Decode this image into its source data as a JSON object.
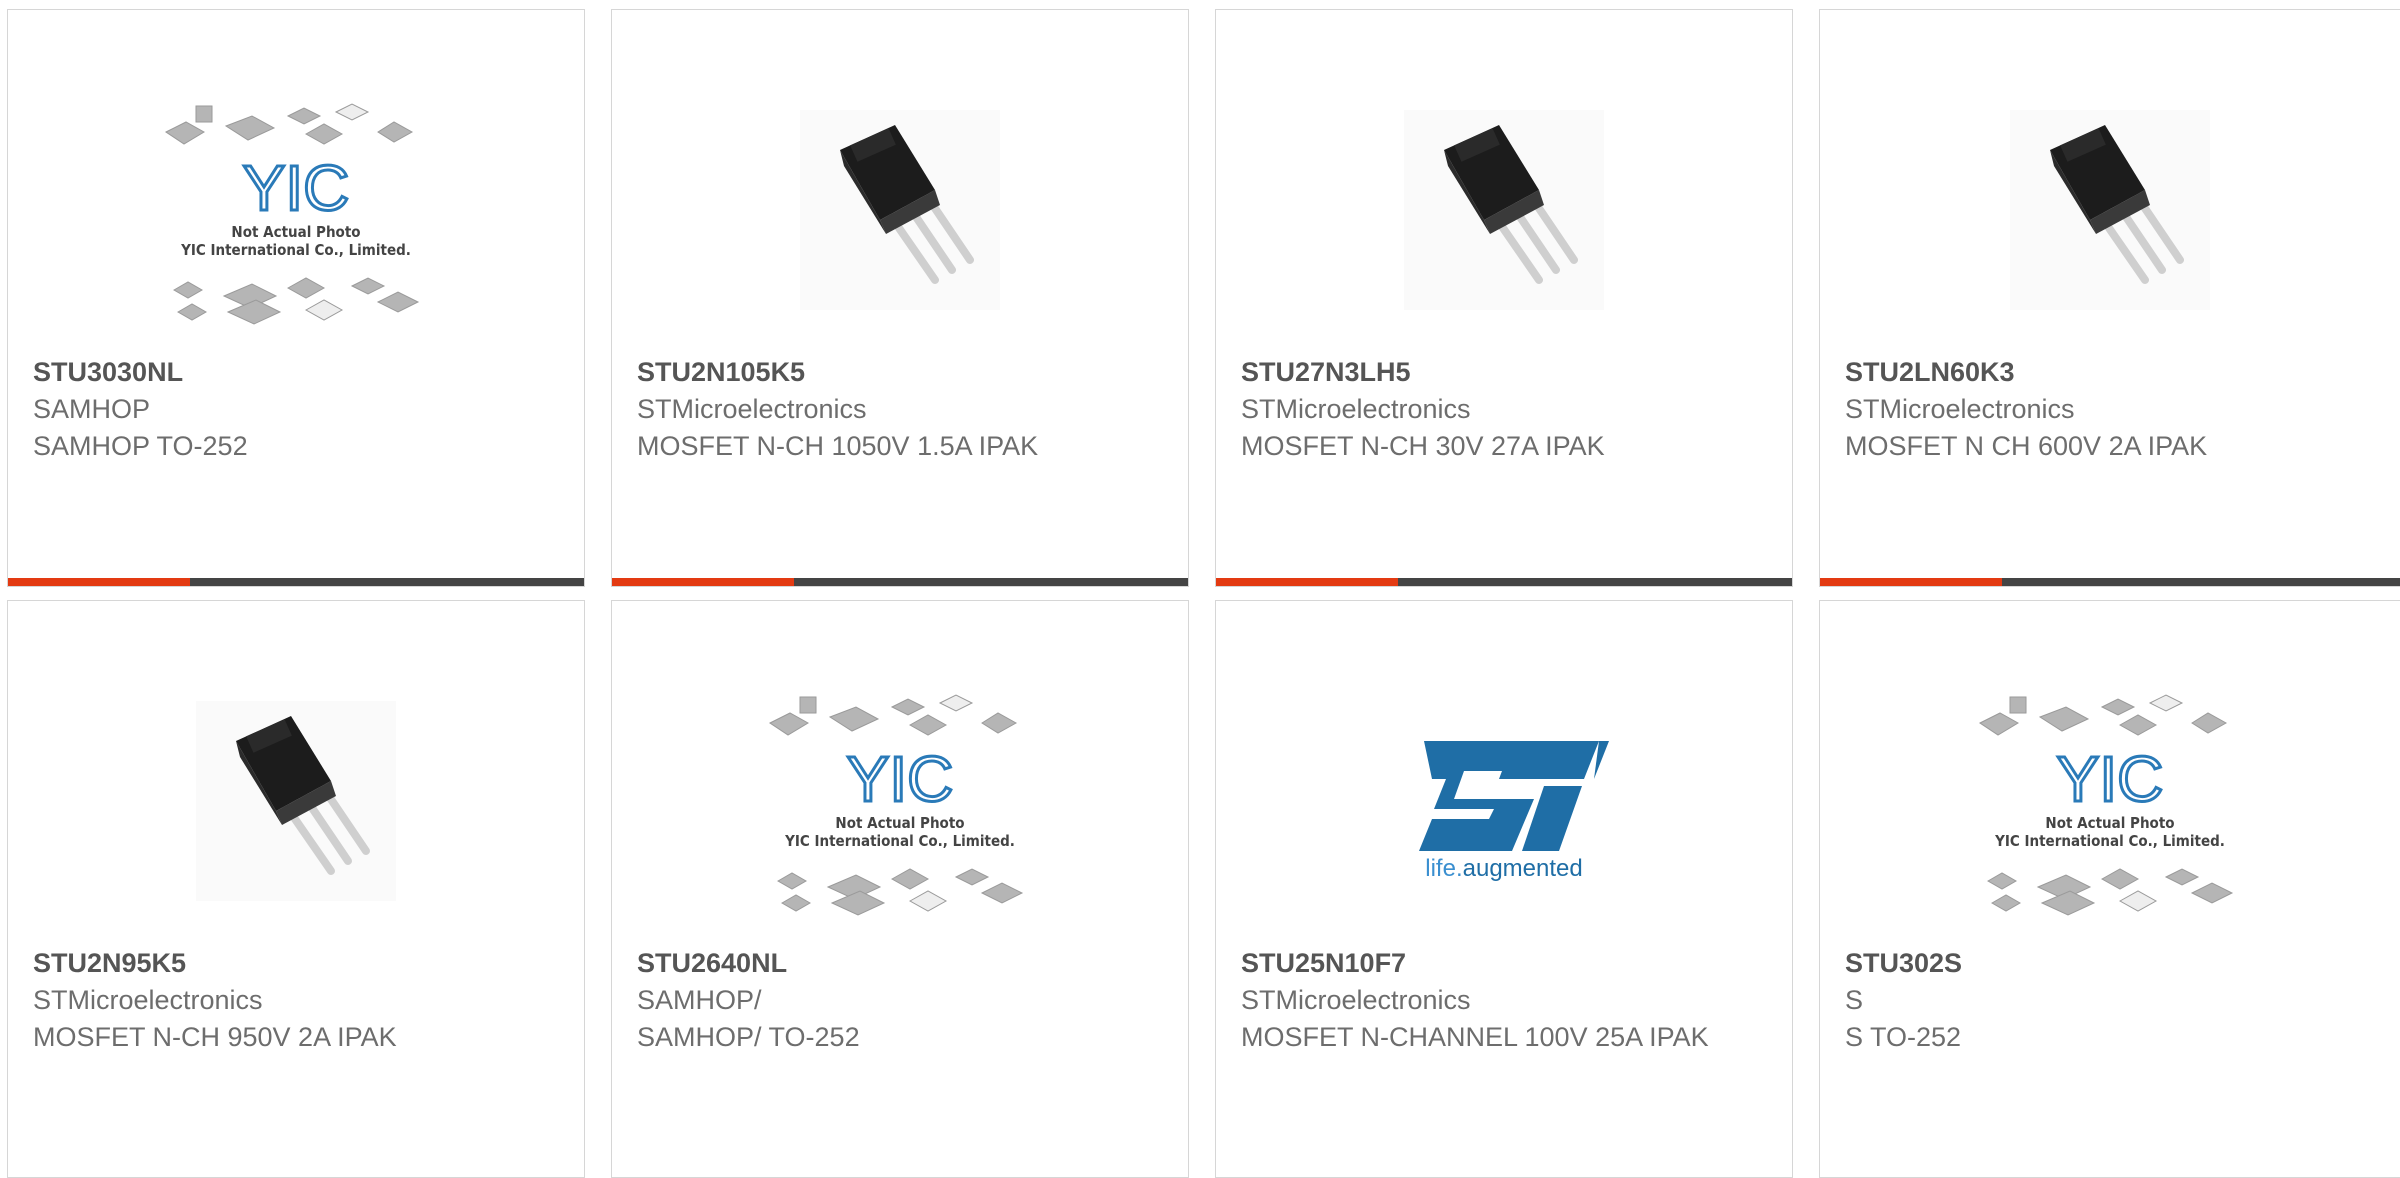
{
  "products": [
    {
      "part": "STU3030NL",
      "maker": "SAMHOP",
      "desc": "SAMHOP TO-252",
      "image": "yic-placeholder"
    },
    {
      "part": "STU2N105K5",
      "maker": "STMicroelectronics",
      "desc": "MOSFET N-CH 1050V 1.5A IPAK",
      "image": "ipak-transistor"
    },
    {
      "part": "STU27N3LH5",
      "maker": "STMicroelectronics",
      "desc": "MOSFET N-CH 30V 27A IPAK",
      "image": "ipak-transistor"
    },
    {
      "part": "STU2LN60K3",
      "maker": "STMicroelectronics",
      "desc": "MOSFET N CH 600V 2A IPAK",
      "image": "ipak-transistor"
    },
    {
      "part": "STU2N95K5",
      "maker": "STMicroelectronics",
      "desc": "MOSFET N-CH 950V 2A IPAK",
      "image": "ipak-transistor"
    },
    {
      "part": "STU2640NL",
      "maker": "SAMHOP/",
      "desc": "SAMHOP/ TO-252",
      "image": "yic-placeholder"
    },
    {
      "part": "STU25N10F7",
      "maker": "STMicroelectronics",
      "desc": "MOSFET N-CHANNEL 100V 25A IPAK",
      "image": "st-logo"
    },
    {
      "part": "STU302S",
      "maker": "S",
      "desc": "S TO-252",
      "image": "yic-placeholder"
    }
  ],
  "placeholder": {
    "line1": "Not Actual Photo",
    "line2": "YIC International Co., Limited."
  },
  "st_logo": {
    "tagline_a": "life.",
    "tagline_b": "augmented"
  },
  "colors": {
    "accent": "#e33a12",
    "bar": "#444444",
    "st_blue": "#1f6ea6"
  }
}
